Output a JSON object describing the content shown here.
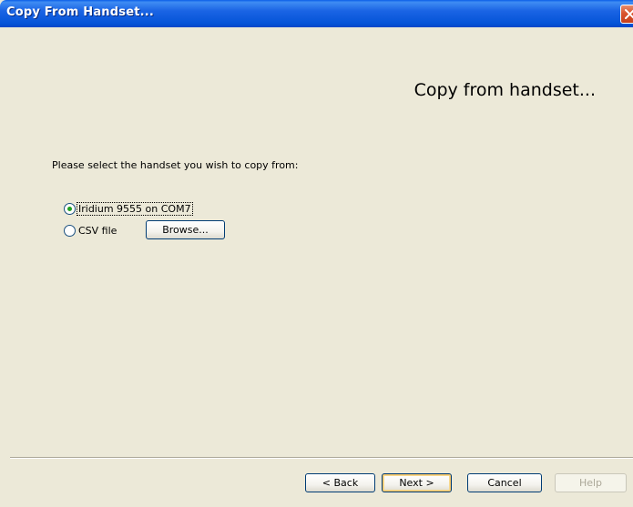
{
  "window": {
    "title": "Copy From Handset..."
  },
  "main": {
    "heading": "Copy from handset...",
    "prompt": "Please select the handset you wish to copy from:",
    "options": [
      {
        "label": "Iridium 9555 on COM7",
        "selected": true
      },
      {
        "label": "CSV file",
        "selected": false
      }
    ],
    "browse_label": "Browse..."
  },
  "footer": {
    "back_label": "Back",
    "next_label": "Next >",
    "cancel_label": "Cancel",
    "help_label": "Help"
  }
}
